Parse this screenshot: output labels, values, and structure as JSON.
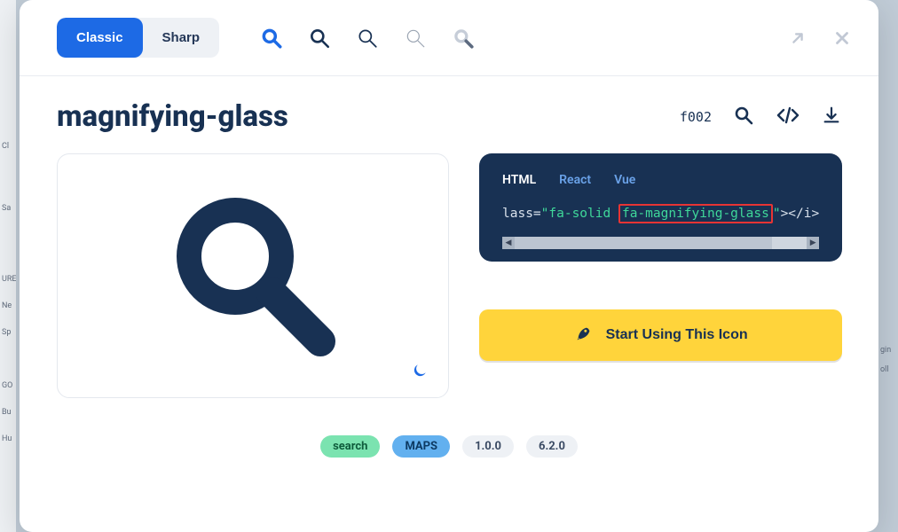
{
  "header": {
    "styles": {
      "classic": "Classic",
      "sharp": "Sharp"
    },
    "variantColors": [
      "#1d6ae5",
      "#183153",
      "#183153",
      "#c1c8d4",
      "#8d97a6"
    ]
  },
  "icon": {
    "name": "magnifying-glass",
    "unicode": "f002"
  },
  "code": {
    "tabs": {
      "html": "HTML",
      "react": "React",
      "vue": "Vue"
    },
    "snippet": {
      "prefix": "lass=",
      "quote": "\"",
      "cls1": "fa-solid",
      "cls2": "fa-magnifying-glass",
      "suffix": "></i>"
    }
  },
  "cta": {
    "label": "Start Using This Icon"
  },
  "tags": {
    "search": "search",
    "maps": "MAPS",
    "v1": "1.0.0",
    "v2": "6.2.0"
  },
  "side": {
    "a": "Cl",
    "b": "Sa",
    "c": "URE",
    "d": "Ne",
    "e": "Sp",
    "f": "GO",
    "g": "Bu",
    "h": "Hu"
  },
  "right": {
    "a": "gin",
    "b": "oll"
  }
}
